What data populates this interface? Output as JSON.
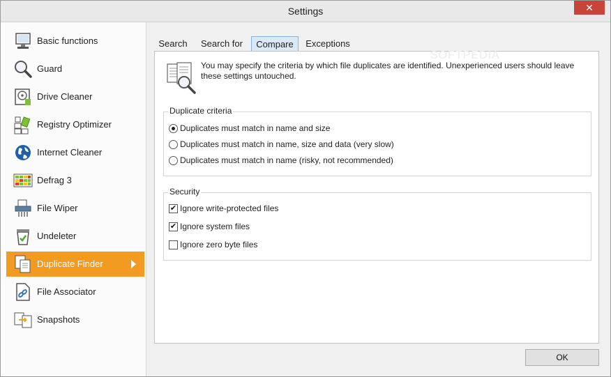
{
  "window": {
    "title": "Settings",
    "close_glyph": "✕"
  },
  "sidebar": {
    "items": [
      {
        "label": "Basic functions",
        "icon": "monitor-icon",
        "active": false
      },
      {
        "label": "Guard",
        "icon": "magnifier-icon",
        "active": false
      },
      {
        "label": "Drive Cleaner",
        "icon": "disk-icon",
        "active": false
      },
      {
        "label": "Registry Optimizer",
        "icon": "registry-icon",
        "active": false
      },
      {
        "label": "Internet Cleaner",
        "icon": "globe-icon",
        "active": false
      },
      {
        "label": "Defrag 3",
        "icon": "defrag-icon",
        "active": false
      },
      {
        "label": "File Wiper",
        "icon": "shredder-icon",
        "active": false
      },
      {
        "label": "Undeleter",
        "icon": "recycle-bin-icon",
        "active": false
      },
      {
        "label": "Duplicate Finder",
        "icon": "duplicate-files-icon",
        "active": true
      },
      {
        "label": "File Associator",
        "icon": "file-link-icon",
        "active": false
      },
      {
        "label": "Snapshots",
        "icon": "snapshot-icon",
        "active": false
      }
    ]
  },
  "tabs": [
    {
      "label": "Search",
      "active": false
    },
    {
      "label": "Search for",
      "active": false
    },
    {
      "label": "Compare",
      "active": true
    },
    {
      "label": "Exceptions",
      "active": false
    }
  ],
  "intro": {
    "text": "You may specify the criteria by which file duplicates are identified. Unexperienced users should leave these settings untouched."
  },
  "duplicate_criteria": {
    "title": "Duplicate criteria",
    "options": [
      {
        "label": "Duplicates must match in name and size",
        "selected": true
      },
      {
        "label": "Duplicates must match in name, size and data (very slow)",
        "selected": false
      },
      {
        "label": "Duplicates must match in name (risky, not recommended)",
        "selected": false
      }
    ]
  },
  "security": {
    "title": "Security",
    "options": [
      {
        "label": "Ignore write-protected files",
        "checked": true
      },
      {
        "label": "Ignore system files",
        "checked": true
      },
      {
        "label": "Ignore zero byte files",
        "checked": false
      }
    ]
  },
  "ok_button": "OK",
  "watermark": "SOFTPEDIA",
  "colors": {
    "accent": "#f29b22",
    "active_tab": "#dbe8f5",
    "close_button": "#c7443a"
  }
}
